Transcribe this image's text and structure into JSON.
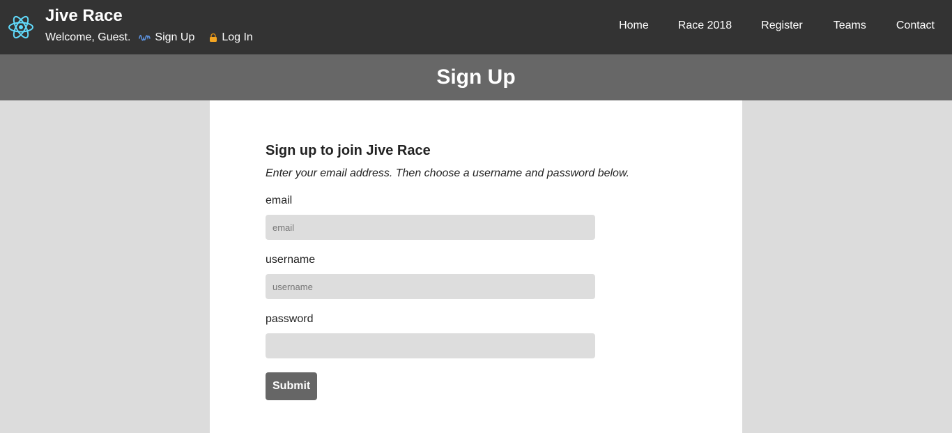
{
  "header": {
    "brand": "Jive Race",
    "welcome": "Welcome, Guest.",
    "signup_link": "Sign Up",
    "login_link": "Log In",
    "logo_icon": "atom-logo-icon",
    "signup_icon": "wave-icon",
    "login_icon": "lock-icon",
    "nav": [
      {
        "label": "Home"
      },
      {
        "label": "Race 2018"
      },
      {
        "label": "Register"
      },
      {
        "label": "Teams"
      },
      {
        "label": "Contact"
      }
    ]
  },
  "banner": {
    "title": "Sign Up"
  },
  "form": {
    "heading": "Sign up to join Jive Race",
    "intro": "Enter your email address. Then choose a username and password below.",
    "fields": {
      "email": {
        "label": "email",
        "placeholder": "email",
        "value": ""
      },
      "username": {
        "label": "username",
        "placeholder": "username",
        "value": ""
      },
      "password": {
        "label": "password",
        "placeholder": "",
        "value": ""
      }
    },
    "submit_label": "Submit"
  },
  "colors": {
    "header_bg": "#333333",
    "banner_bg": "#676767",
    "page_bg": "#dcdcdc",
    "card_bg": "#ffffff",
    "input_bg": "#dddddd",
    "button_bg": "#666666",
    "logo_accent": "#61dafb",
    "lock_accent": "#f5a623"
  }
}
